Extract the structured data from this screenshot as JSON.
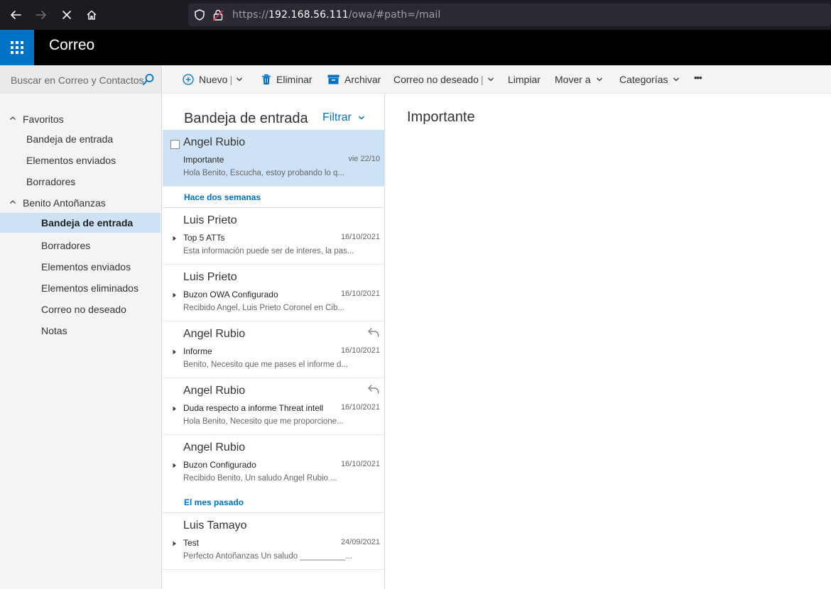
{
  "browser": {
    "url_scheme": "https://",
    "url_host": "192.168.56.111",
    "url_path": "/owa/#path=/mail"
  },
  "header": {
    "app_title": "Correo"
  },
  "search": {
    "placeholder": "Buscar en Correo y Contactos"
  },
  "commands": {
    "new": "Nuevo",
    "delete": "Eliminar",
    "archive": "Archivar",
    "junk": "Correo no deseado",
    "sweep": "Limpiar",
    "move": "Mover a",
    "categories": "Categorías",
    "more": "•••"
  },
  "nav": {
    "favorites_header": "Favoritos",
    "favorites": [
      "Bandeja de entrada",
      "Elementos enviados",
      "Borradores"
    ],
    "account_header": "Benito Antoñanzas",
    "folders": [
      "Bandeja de entrada",
      "Borradores",
      "Elementos enviados",
      "Elementos eliminados",
      "Correo no deseado",
      "Notas"
    ]
  },
  "list": {
    "title": "Bandeja de entrada",
    "filter": "Filtrar",
    "groups": {
      "two_weeks": "Hace dos semanas",
      "last_month": "El mes pasado"
    },
    "messages": [
      {
        "from": "Angel Rubio",
        "subject": "Importante",
        "date": "vie 22/10",
        "preview": "Hola Benito,   Escucha, estoy probando lo q..."
      },
      {
        "from": "Luis Prieto",
        "subject": "Top 5 ATTs",
        "date": "16/10/2021",
        "preview": "Esta información puede ser de interes, la pas..."
      },
      {
        "from": "Luis Prieto",
        "subject": "Buzon OWA Configurado",
        "date": "16/10/2021",
        "preview": "Recibido Angel,   Luis Prieto  Coronel en Cib..."
      },
      {
        "from": "Angel Rubio",
        "subject": "Informe",
        "date": "16/10/2021",
        "preview": "Benito,   Necesito que me pases el informe d..."
      },
      {
        "from": "Angel Rubio",
        "subject": "Duda respecto a informe Threat intelli",
        "date": "16/10/2021",
        "preview": "Hola Benito,   Necesito que me proporcione..."
      },
      {
        "from": "Angel Rubio",
        "subject": "Buzon Configurado",
        "date": "16/10/2021",
        "preview": "Recibido Benito,   Un saludo   Angel Rubio  ..."
      },
      {
        "from": "Luis Tamayo",
        "subject": "Test",
        "date": "24/09/2021",
        "preview": "Perfecto Antoñanzas   Un saludo  __________..."
      }
    ]
  },
  "reading": {
    "title": "Importante"
  },
  "colors": {
    "accent": "#0072c6",
    "selected_bg": "#cde2f4"
  }
}
